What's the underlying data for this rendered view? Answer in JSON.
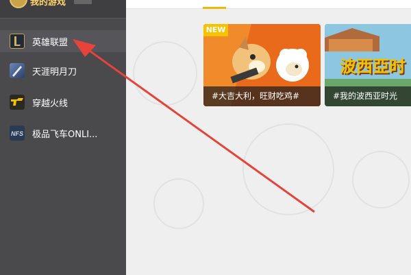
{
  "sidebar": {
    "username": "我的游戏",
    "items": [
      {
        "label": "英雄联盟",
        "icon": "lol-icon",
        "active": true
      },
      {
        "label": "天涯明月刀",
        "icon": "tianya-icon",
        "active": false
      },
      {
        "label": "穿越火线",
        "icon": "cf-icon",
        "active": false
      },
      {
        "label": "极品飞车ONLI...",
        "icon": "nfs-icon",
        "active": false
      }
    ]
  },
  "main": {
    "cards": [
      {
        "badge": "NEW",
        "caption": "#大吉大利，旺财吃鸡#"
      },
      {
        "title": "波西亞时",
        "caption": "#我的波西亚时光"
      }
    ]
  },
  "colors": {
    "sidebar_bg": "#4a4a4d",
    "accent": "#f2b705",
    "arrow": "#e8433a"
  }
}
